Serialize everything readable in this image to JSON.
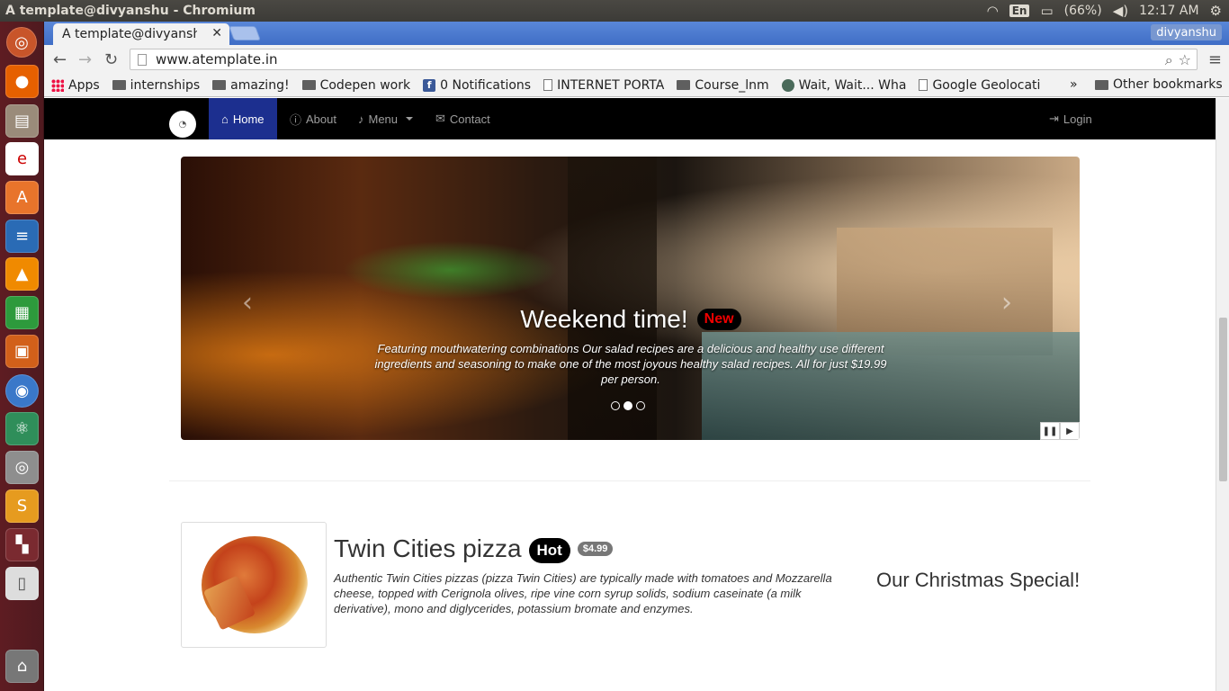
{
  "os": {
    "window_title": "A template@divyanshu - Chromium",
    "battery": "(66%)",
    "clock": "12:17 AM",
    "keyboard_layout": "En"
  },
  "browser": {
    "tab_title": "A template@divyanshu - Chromium",
    "tab_close": "✕",
    "profile_name": "divyanshu",
    "url": "www.atemplate.in",
    "bookmarks": [
      {
        "label": "Apps",
        "icon": "apps-grid-icon"
      },
      {
        "label": "internships",
        "icon": "folder-icon"
      },
      {
        "label": "amazing!",
        "icon": "folder-icon"
      },
      {
        "label": "Codepen work",
        "icon": "folder-icon"
      },
      {
        "label": "0 Notifications",
        "icon": "facebook-icon"
      },
      {
        "label": "INTERNET PORTA",
        "icon": "page-icon"
      },
      {
        "label": "Course_lnm",
        "icon": "folder-icon"
      },
      {
        "label": "Wait, Wait... Wha",
        "icon": "site-icon"
      },
      {
        "label": "Google Geolocati",
        "icon": "page-icon"
      }
    ],
    "bookmarks_overflow": "»",
    "other_bookmarks": "Other bookmarks"
  },
  "site": {
    "nav": {
      "home": "Home",
      "about": "About",
      "menu": "Menu",
      "contact": "Contact",
      "login": "Login"
    },
    "carousel": {
      "heading": "Weekend time!",
      "badge": "New",
      "text": "Featuring mouthwatering combinations Our salad recipes are a delicious and healthy use different ingredients and seasoning to make one of the most joyous healthy salad recipes. All for just $19.99 per person.",
      "slides": 3,
      "active_slide": 2,
      "prev": "‹",
      "next": "›",
      "pause": "❚❚",
      "play": "▶"
    },
    "product": {
      "title": "Twin Cities pizza",
      "badge": "Hot",
      "price": "$4.99",
      "description": "Authentic Twin Cities pizzas (pizza Twin Cities) are typically made with tomatoes and Mozzarella cheese, topped with Cerignola olives, ripe vine corn syrup solids, sodium caseinate (a milk derivative), mono and diglycerides, potassium bromate and enzymes."
    },
    "special": "Our Christmas Special!"
  },
  "colors": {
    "navbar_bg": "#000000",
    "nav_active": "#1c2f8f",
    "launcher_bg": "#5e1c22",
    "tabstrip": "#4a7bd0"
  }
}
